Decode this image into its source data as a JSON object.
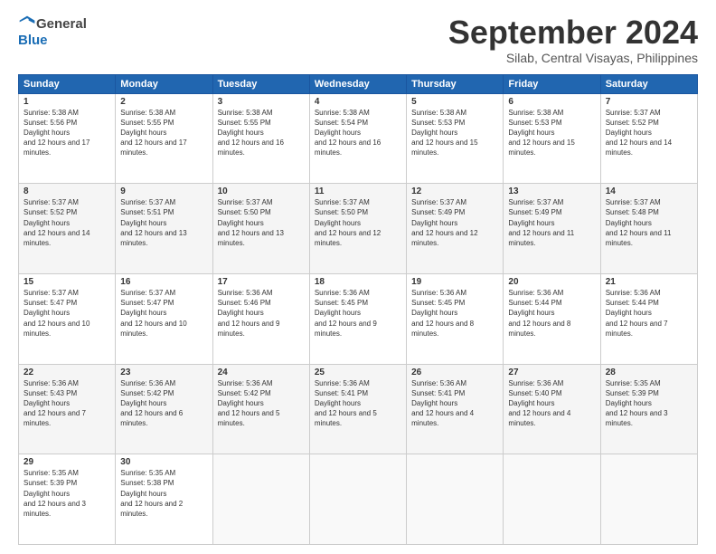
{
  "header": {
    "logo_general": "General",
    "logo_blue": "Blue",
    "month_title": "September 2024",
    "location": "Silab, Central Visayas, Philippines"
  },
  "calendar": {
    "days_of_week": [
      "Sunday",
      "Monday",
      "Tuesday",
      "Wednesday",
      "Thursday",
      "Friday",
      "Saturday"
    ],
    "weeks": [
      [
        null,
        null,
        {
          "day": "3",
          "sunrise": "5:38 AM",
          "sunset": "5:55 PM",
          "daylight": "12 hours and 16 minutes."
        },
        {
          "day": "4",
          "sunrise": "5:38 AM",
          "sunset": "5:54 PM",
          "daylight": "12 hours and 16 minutes."
        },
        {
          "day": "5",
          "sunrise": "5:38 AM",
          "sunset": "5:53 PM",
          "daylight": "12 hours and 15 minutes."
        },
        {
          "day": "6",
          "sunrise": "5:38 AM",
          "sunset": "5:53 PM",
          "daylight": "12 hours and 15 minutes."
        },
        {
          "day": "7",
          "sunrise": "5:37 AM",
          "sunset": "5:52 PM",
          "daylight": "12 hours and 14 minutes."
        }
      ],
      [
        {
          "day": "1",
          "sunrise": "5:38 AM",
          "sunset": "5:56 PM",
          "daylight": "12 hours and 17 minutes."
        },
        {
          "day": "2",
          "sunrise": "5:38 AM",
          "sunset": "5:55 PM",
          "daylight": "12 hours and 17 minutes."
        },
        null,
        null,
        null,
        null,
        null
      ],
      [
        {
          "day": "8",
          "sunrise": "5:37 AM",
          "sunset": "5:52 PM",
          "daylight": "12 hours and 14 minutes."
        },
        {
          "day": "9",
          "sunrise": "5:37 AM",
          "sunset": "5:51 PM",
          "daylight": "12 hours and 13 minutes."
        },
        {
          "day": "10",
          "sunrise": "5:37 AM",
          "sunset": "5:50 PM",
          "daylight": "12 hours and 13 minutes."
        },
        {
          "day": "11",
          "sunrise": "5:37 AM",
          "sunset": "5:50 PM",
          "daylight": "12 hours and 12 minutes."
        },
        {
          "day": "12",
          "sunrise": "5:37 AM",
          "sunset": "5:49 PM",
          "daylight": "12 hours and 12 minutes."
        },
        {
          "day": "13",
          "sunrise": "5:37 AM",
          "sunset": "5:49 PM",
          "daylight": "12 hours and 11 minutes."
        },
        {
          "day": "14",
          "sunrise": "5:37 AM",
          "sunset": "5:48 PM",
          "daylight": "12 hours and 11 minutes."
        }
      ],
      [
        {
          "day": "15",
          "sunrise": "5:37 AM",
          "sunset": "5:47 PM",
          "daylight": "12 hours and 10 minutes."
        },
        {
          "day": "16",
          "sunrise": "5:37 AM",
          "sunset": "5:47 PM",
          "daylight": "12 hours and 10 minutes."
        },
        {
          "day": "17",
          "sunrise": "5:36 AM",
          "sunset": "5:46 PM",
          "daylight": "12 hours and 9 minutes."
        },
        {
          "day": "18",
          "sunrise": "5:36 AM",
          "sunset": "5:45 PM",
          "daylight": "12 hours and 9 minutes."
        },
        {
          "day": "19",
          "sunrise": "5:36 AM",
          "sunset": "5:45 PM",
          "daylight": "12 hours and 8 minutes."
        },
        {
          "day": "20",
          "sunrise": "5:36 AM",
          "sunset": "5:44 PM",
          "daylight": "12 hours and 8 minutes."
        },
        {
          "day": "21",
          "sunrise": "5:36 AM",
          "sunset": "5:44 PM",
          "daylight": "12 hours and 7 minutes."
        }
      ],
      [
        {
          "day": "22",
          "sunrise": "5:36 AM",
          "sunset": "5:43 PM",
          "daylight": "12 hours and 7 minutes."
        },
        {
          "day": "23",
          "sunrise": "5:36 AM",
          "sunset": "5:42 PM",
          "daylight": "12 hours and 6 minutes."
        },
        {
          "day": "24",
          "sunrise": "5:36 AM",
          "sunset": "5:42 PM",
          "daylight": "12 hours and 5 minutes."
        },
        {
          "day": "25",
          "sunrise": "5:36 AM",
          "sunset": "5:41 PM",
          "daylight": "12 hours and 5 minutes."
        },
        {
          "day": "26",
          "sunrise": "5:36 AM",
          "sunset": "5:41 PM",
          "daylight": "12 hours and 4 minutes."
        },
        {
          "day": "27",
          "sunrise": "5:36 AM",
          "sunset": "5:40 PM",
          "daylight": "12 hours and 4 minutes."
        },
        {
          "day": "28",
          "sunrise": "5:35 AM",
          "sunset": "5:39 PM",
          "daylight": "12 hours and 3 minutes."
        }
      ],
      [
        {
          "day": "29",
          "sunrise": "5:35 AM",
          "sunset": "5:39 PM",
          "daylight": "12 hours and 3 minutes."
        },
        {
          "day": "30",
          "sunrise": "5:35 AM",
          "sunset": "5:38 PM",
          "daylight": "12 hours and 2 minutes."
        },
        null,
        null,
        null,
        null,
        null
      ]
    ]
  }
}
